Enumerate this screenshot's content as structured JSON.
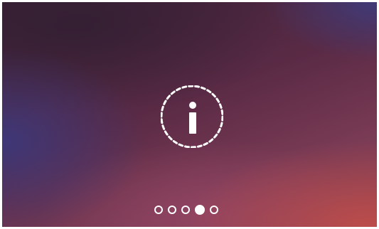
{
  "screen": {
    "center_icon": "info-icon",
    "accent_color": "#ffffff"
  },
  "pager": {
    "count": 5,
    "active_index": 3
  }
}
